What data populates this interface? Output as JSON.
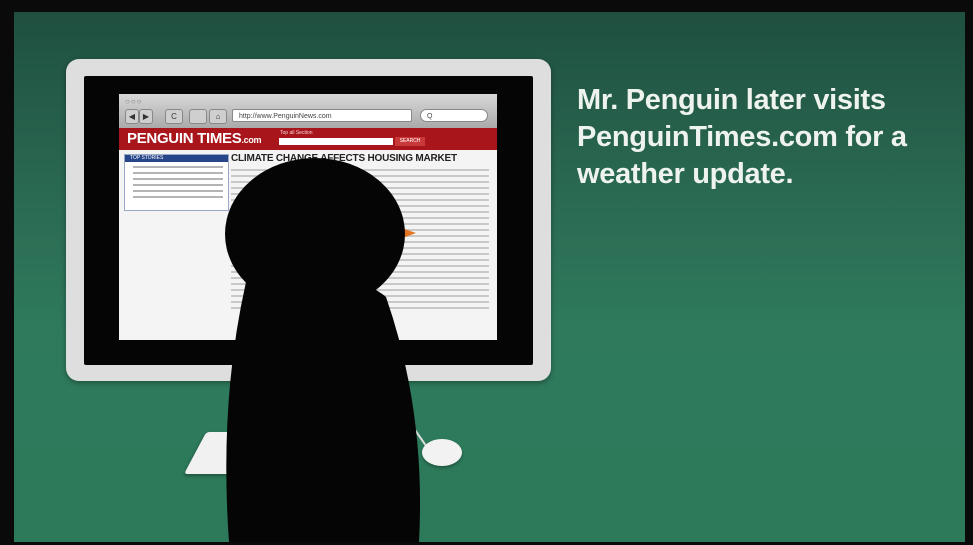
{
  "caption": "Mr. Penguin later visits PenguinTimes.com for a weather update.",
  "browser": {
    "window_dots": "○○○",
    "back_label": "◀",
    "forward_label": "▶",
    "reload_label": "C",
    "home_label": "⌂",
    "address": "http://www.PenguinNews.com",
    "search_placeholder": "Q"
  },
  "site": {
    "brand_main": "PENGUIN TIMES",
    "brand_suffix": ".com",
    "nav_text": "Top   all   Section",
    "search_button": "SEARCH",
    "top_stories_label": "TOP STORIES",
    "headline": "CLIMATE CHANGE AFFECTS HOUSING MARKET"
  },
  "colors": {
    "background_green": "#2a6a52",
    "site_red": "#a8161b",
    "penguin": "#050505",
    "beak": "#e4731f"
  }
}
